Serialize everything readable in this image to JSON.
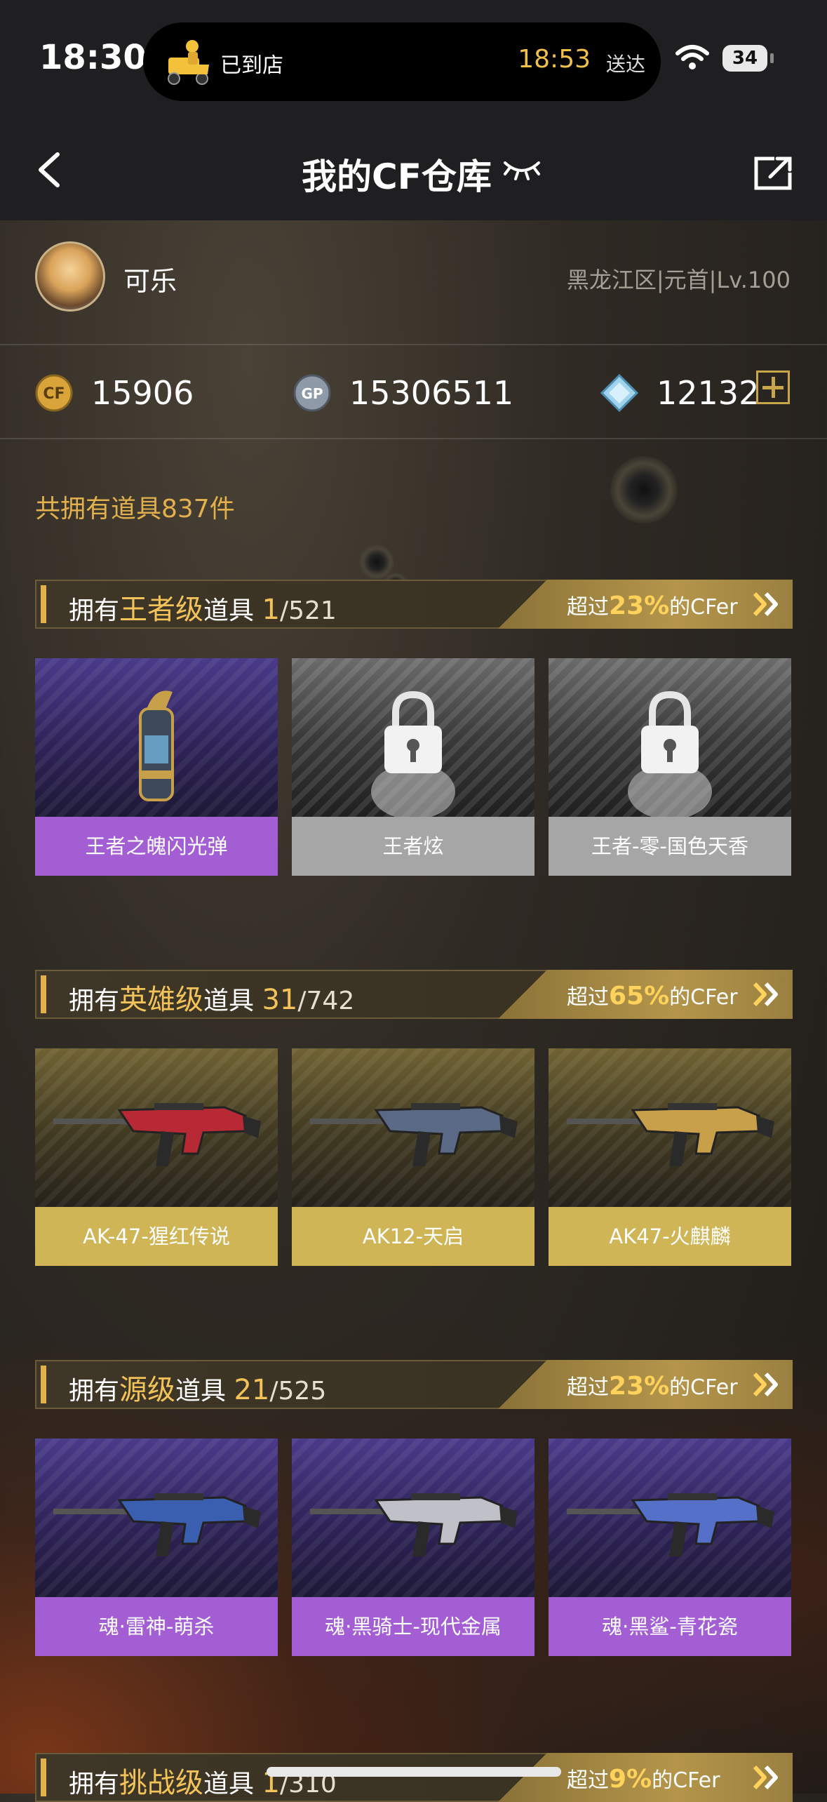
{
  "status_bar": {
    "time": "18:30",
    "activity": {
      "status": "已到店",
      "eta_time": "18:53",
      "eta_suffix": "送达"
    },
    "battery": "34"
  },
  "nav": {
    "title": "我的CF仓库"
  },
  "profile": {
    "name": "可乐",
    "region": "黑龙江区|元首|Lv.100"
  },
  "currency": {
    "cf_points": "15906",
    "gp": "15306511",
    "diamonds": "12132"
  },
  "summary": "共拥有道具837件",
  "sections": [
    {
      "prefix": "拥有",
      "tier": "王者级",
      "suffix": "道具",
      "owned": "1",
      "total": "/521",
      "rank_prefix": "超过",
      "rank_pct": "23%",
      "rank_suffix": "的CFer",
      "items": [
        {
          "name": "王者之魄闪光弹",
          "style": "purple",
          "locked": false
        },
        {
          "name": "王者炫",
          "style": "gray",
          "locked": true
        },
        {
          "name": "王者-零-国色天香",
          "style": "gray",
          "locked": true
        }
      ]
    },
    {
      "prefix": "拥有",
      "tier": "英雄级",
      "suffix": "道具",
      "owned": "31",
      "total": "/742",
      "rank_prefix": "超过",
      "rank_pct": "65%",
      "rank_suffix": "的CFer",
      "items": [
        {
          "name": "AK-47-猩红传说",
          "style": "gold",
          "locked": false
        },
        {
          "name": "AK12-天启",
          "style": "gold",
          "locked": false
        },
        {
          "name": "AK47-火麒麟",
          "style": "gold",
          "locked": false
        }
      ]
    },
    {
      "prefix": "拥有",
      "tier": "源级",
      "suffix": "道具",
      "owned": "21",
      "total": "/525",
      "rank_prefix": "超过",
      "rank_pct": "23%",
      "rank_suffix": "的CFer",
      "items": [
        {
          "name": "魂·雷神-萌杀",
          "style": "purple",
          "locked": false
        },
        {
          "name": "魂·黑骑士-现代金属",
          "style": "purple",
          "locked": false
        },
        {
          "name": "魂·黑鲨-青花瓷",
          "style": "purple",
          "locked": false
        }
      ]
    },
    {
      "prefix": "拥有",
      "tier": "挑战级",
      "suffix": "道具",
      "owned": "1",
      "total": "/310",
      "rank_prefix": "超过",
      "rank_pct": "9%",
      "rank_suffix": "的CFer",
      "items": []
    }
  ],
  "colors": {
    "accent_gold": "#e2b04c",
    "purple_label": "#a35ed4",
    "gray_label": "#a6a6a6",
    "gold_label": "#cfb555"
  }
}
